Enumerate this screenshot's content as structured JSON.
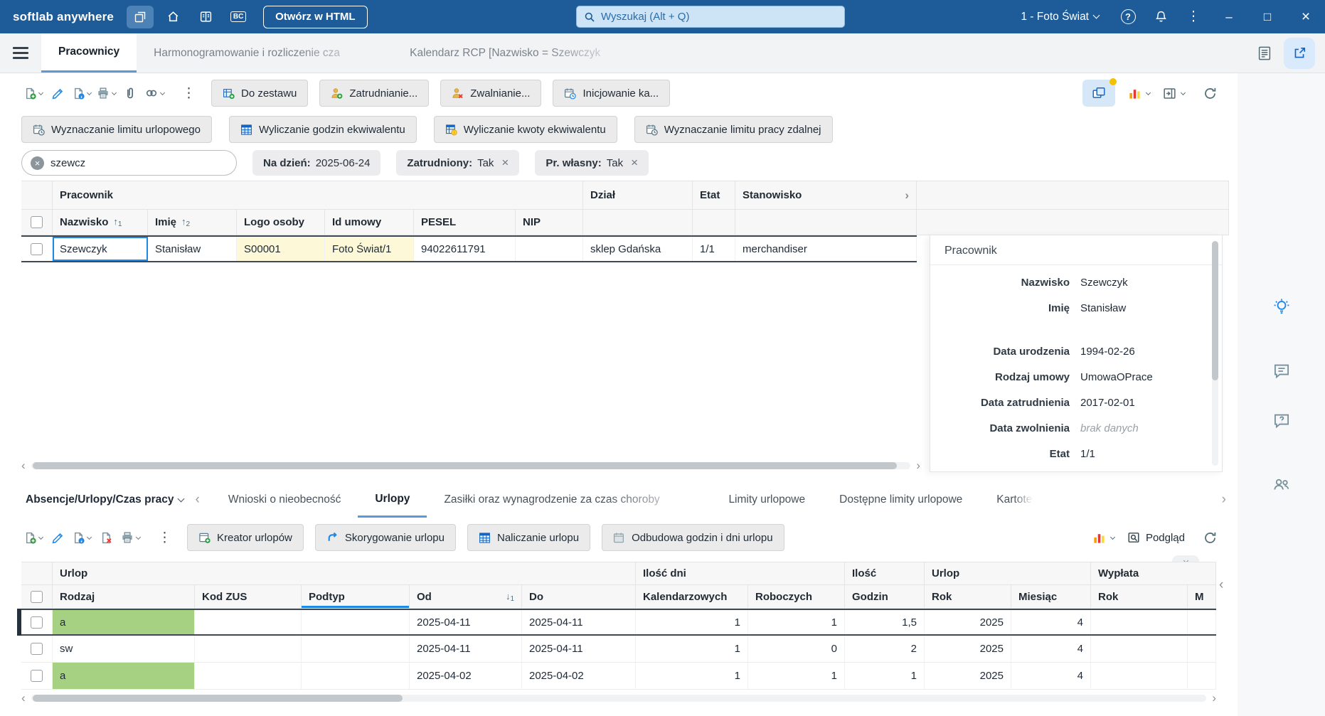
{
  "titlebar": {
    "brand": "softlab anywhere",
    "open_html_button": "Otwórz w HTML",
    "search_placeholder": "Wyszukaj (Alt + Q)",
    "company_selector": "1 - Foto Świat"
  },
  "icons": {
    "minimize": "–",
    "maximize": "□",
    "close": "×",
    "help": "?",
    "more_vertical": "⋮",
    "sort_asc": "↑",
    "sort_desc": "↓",
    "scroll_left": "‹",
    "scroll_right": "›",
    "clear_search": "×",
    "chip_remove": "×",
    "bc_module": "BC"
  },
  "tabbar": {
    "tabs": [
      "Pracownicy",
      "Harmonogramowanie i rozliczenie cza",
      "Kalendarz RCP [Nazwisko = Szewczyk"
    ]
  },
  "toolbar": {
    "actions": [
      "Do zestawu",
      "Zatrudnianie...",
      "Zwalnianie...",
      "Inicjowanie ka..."
    ],
    "operations": [
      "Wyznaczanie limitu urlopowego",
      "Wyliczanie godzin ekwiwalentu",
      "Wyliczanie kwoty ekwiwalentu",
      "Wyznaczanie limitu pracy zdalnej"
    ]
  },
  "filters": {
    "search_value": "szewcz",
    "chips": [
      {
        "label": "Na dzień:",
        "value": "2025-06-24"
      },
      {
        "label": "Zatrudniony:",
        "value": "Tak"
      },
      {
        "label": "Pr. własny:",
        "value": "Tak"
      }
    ]
  },
  "employees": {
    "groups": {
      "pracownik": "Pracownik",
      "dzial": "Dział",
      "etat": "Etat",
      "stanowisko": "Stanowisko"
    },
    "columns": {
      "nazwisko": "Nazwisko",
      "imie": "Imię",
      "logo": "Logo osoby",
      "id_umowy": "Id umowy",
      "pesel": "PESEL",
      "nip": "NIP"
    },
    "sort": {
      "nazwisko": "1",
      "imie": "2"
    },
    "rows": [
      {
        "nazwisko": "Szewczyk",
        "imie": "Stanisław",
        "logo": "S00001",
        "id_umowy": "Foto Świat/1",
        "pesel": "94022611791",
        "nip": "",
        "dzial": "sklep Gdańska",
        "etat": "1/1",
        "stanowisko": "merchandiser"
      }
    ]
  },
  "detail_panel": {
    "title": "Pracownik",
    "fields": [
      {
        "label": "Nazwisko",
        "value": "Szewczyk"
      },
      {
        "label": "Imię",
        "value": "Stanisław"
      },
      {
        "label": "Data urodzenia",
        "value": "1994-02-26"
      },
      {
        "label": "Rodzaj umowy",
        "value": "UmowaOPrace"
      },
      {
        "label": "Data zatrudnienia",
        "value": "2017-02-01"
      },
      {
        "label": "Data zwolnienia",
        "value": "brak danych"
      },
      {
        "label": "Etat",
        "value": "1/1"
      }
    ]
  },
  "bottom": {
    "section_selector": "Absencje/Urlopy/Czas pracy",
    "tabs": [
      "Wnioski o nieobecność",
      "Urlopy",
      "Zasiłki oraz wynagrodzenie za czas choroby",
      "Limity urlopowe",
      "Dostępne limity urlopowe",
      "Kartotek"
    ],
    "active_tab": "Urlopy",
    "actions": [
      "Kreator urlopów",
      "Skorygowanie urlopu",
      "Naliczanie urlopu",
      "Odbudowa godzin i dni urlopu"
    ],
    "preview_button": "Podgląd"
  },
  "leaves": {
    "groups": {
      "urlop1": "Urlop",
      "ilosc_dni": "Ilość dni",
      "ilosc": "Ilość",
      "urlop2": "Urlop",
      "wyplata": "Wypłata"
    },
    "columns": {
      "rodzaj": "Rodzaj",
      "kod_zus": "Kod ZUS",
      "podtyp": "Podtyp",
      "od": "Od",
      "do": "Do",
      "kalendarzowych": "Kalendarzowych",
      "roboczych": "Roboczych",
      "godzin": "Godzin",
      "rok": "Rok",
      "miesiac": "Miesiąc",
      "rok2": "Rok",
      "m": "M"
    },
    "sort_od": "1",
    "rows": [
      {
        "rodzaj": "a",
        "kod_zus": "",
        "podtyp": "",
        "od": "2025-04-11",
        "do": "2025-04-11",
        "kalendarzowych": "1",
        "roboczych": "1",
        "godzin": "1,5",
        "rok": "2025",
        "miesiac": "4",
        "rok2": "",
        "m": ""
      },
      {
        "rodzaj": "sw",
        "kod_zus": "",
        "podtyp": "",
        "od": "2025-04-11",
        "do": "2025-04-11",
        "kalendarzowych": "1",
        "roboczych": "0",
        "godzin": "2",
        "rok": "2025",
        "miesiac": "4",
        "rok2": "",
        "m": ""
      },
      {
        "rodzaj": "a",
        "kod_zus": "",
        "podtyp": "",
        "od": "2025-04-02",
        "do": "2025-04-02",
        "kalendarzowych": "1",
        "roboczych": "1",
        "godzin": "1",
        "rok": "2025",
        "miesiac": "4",
        "rok2": "",
        "m": ""
      }
    ]
  },
  "colors": {
    "titlebar_blue": "#1d5c99",
    "accent_blue": "#1e88e5",
    "active_tab_underline": "#5b9bd5",
    "cell_yellow": "#fcf8d8",
    "cell_green": "#a6d183",
    "notification_dot": "#f2c200"
  }
}
